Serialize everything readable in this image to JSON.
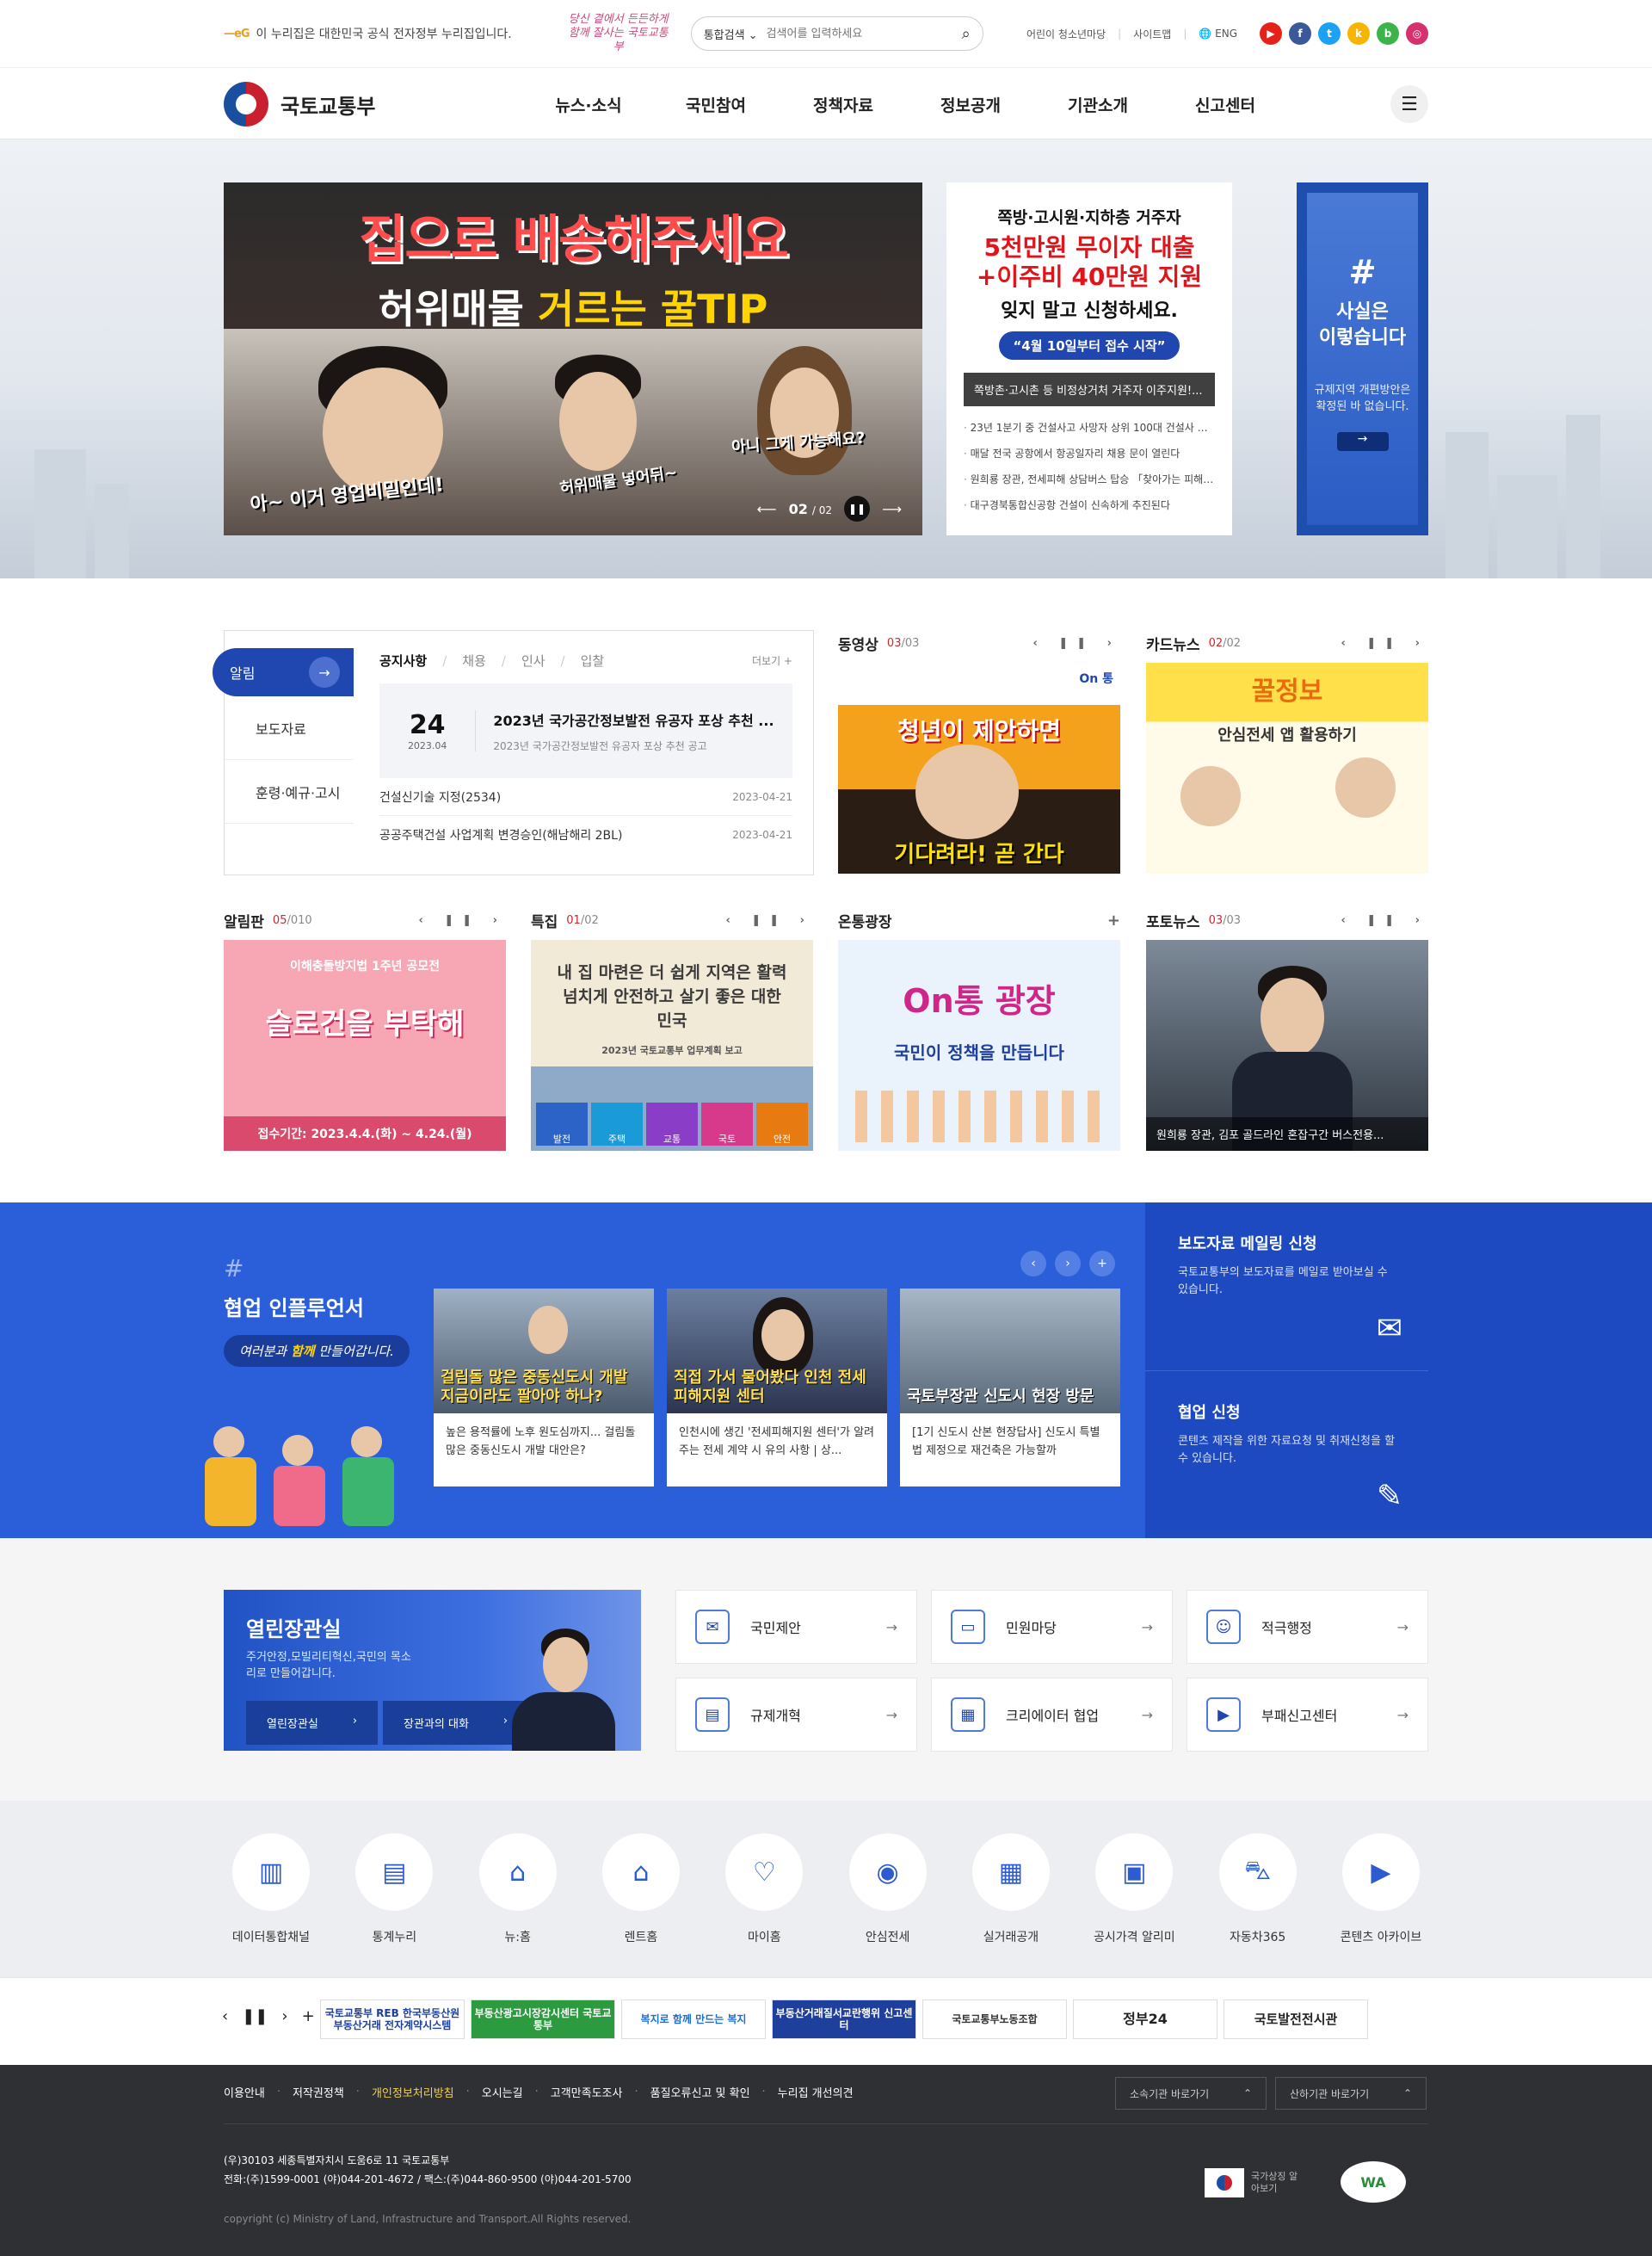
{
  "top": {
    "gov_mark": "이 누리집은 대한민국 공식 전자정부 누리집입니다.",
    "slogan": "당신 곁에서 든든하게 함께 잘사는 국토교통부",
    "search_scope": "통합검색",
    "search_placeholder": "검색어를 입력하세요",
    "util": [
      "어린이 청소년마당",
      "사이트맵",
      "ENG"
    ],
    "sns": [
      "youtube",
      "facebook",
      "twitter",
      "kakaostory",
      "blog",
      "instagram"
    ]
  },
  "gnb": {
    "logo": "국토교통부",
    "menu": [
      "뉴스·소식",
      "국민참여",
      "정책자료",
      "정보공개",
      "기관소개",
      "신고센터"
    ]
  },
  "hero": {
    "main_title": "집으로 배송해주세요",
    "main_sub_a": "허위매물 ",
    "main_sub_b": "거르는 꿀TIP",
    "cap1": "아~ 이거 영업비밀인데!",
    "cap2": "허위매물 넣어뒤~",
    "cap3": "아니 그게 가능해요?",
    "pager": "02",
    "pager_total": "/ 02",
    "card_a": "쪽방·고시원·지하층 거주자",
    "card_b1": "5천만원 무이자 대출",
    "card_b2": "+이주비 40만원 지원",
    "card_c": "잊지 말고 신청하세요.",
    "card_d": "“4월 10일부터 접수 시작”",
    "card_cap": "쪽방촌·고시촌 등 비정상거처 거주자 이주지원!...",
    "card_list": [
      "23년 1분기 중 건설사고 사망자 상위 100대 건설사 명단 ...",
      "매달 전국 공항에서 항공일자리 채용 문이 열린다",
      "원희룡 장관, 전세피해 상담버스 탑승 「찾아가는 피해지...",
      "대구경북통합신공항 건설이 신속하게 추진된다"
    ],
    "fact_hash": "#",
    "fact_t1": "사실은",
    "fact_t2": "이렇습니다",
    "fact_s": "규제지역 개편방안은 확정된 바 없습니다."
  },
  "notice": {
    "tabs": [
      "알림",
      "보도자료",
      "훈령·예규·고시"
    ],
    "subs": [
      "공지사항",
      "채용",
      "인사",
      "입찰"
    ],
    "more": "더보기 +",
    "feat_day": "24",
    "feat_ym": "2023.04",
    "feat_title": "2023년 국가공간정보발전 유공자 포상 추천 ...",
    "feat_sub": "2023년 국가공간정보발전 유공자 포상 추천 공고",
    "rows": [
      {
        "t": "건설신기술 지정(2534)",
        "d": "2023-04-21"
      },
      {
        "t": "공공주택건설 사업계획 변경승인(해남해리 2BL)",
        "d": "2023-04-21"
      }
    ]
  },
  "tiles": [
    {
      "title": "동영상",
      "cur": "03",
      "tot": "/03",
      "big": "청년이 제안하면",
      "sub": "기다려라! 곧 간다",
      "tag": "On 통"
    },
    {
      "title": "카드뉴스",
      "cur": "02",
      "tot": "/02",
      "big": "꿀정보",
      "sub": "안심전세 앱 활용하기"
    },
    {
      "title": "알림판",
      "cur": "05",
      "tot": "/010",
      "big": "슬로건을 부탁해",
      "sub": "접수기간: 2023.4.4.(화) ~ 4.24.(월)",
      "tag": "이해충돌방지법 1주년 공모전"
    },
    {
      "title": "특집",
      "cur": "01",
      "tot": "/02",
      "big": "내 집 마련은 더 쉽게 지역은 활력 넘치게 안전하고 살기 좋은 대한민국",
      "sub": "2023년 국토교통부 업무계획 보고",
      "chips": [
        "발전",
        "주택",
        "교통",
        "국토",
        "안전"
      ]
    },
    {
      "title": "온통광장",
      "cur": "",
      "tot": "",
      "big": "On통 광장",
      "sub": "국민이 정책을 만듭니다"
    },
    {
      "title": "포토뉴스",
      "cur": "03",
      "tot": "/03",
      "cap": "원희룡 장관, 김포 골드라인 혼잡구간 버스전용..."
    }
  ],
  "influencer": {
    "hash": "#",
    "title": "협업 인플루언서",
    "slogan_a": "여러분과 ",
    "slogan_b": "함께",
    "slogan_c": " 만들어갑니다.",
    "cards": [
      {
        "cap": "걸림돌 많은 중동신도시 개발 지금이라도 팔아야 하나?",
        "txt": "높은 용적률에 노후 원도심까지... 걸림돌 많은 중동신도시 개발 대안은?"
      },
      {
        "cap": "직접 가서 물어봤다 인천 전세피해지원 센터",
        "txt": "인천시에 생긴 '전세피해지원 센터'가 알려주는 전세 계약 시 유의 사항 | 상..."
      },
      {
        "cap": "국토부장관 신도시 현장 방문",
        "txt": "[1기 신도시 산본 현장답사] 신도시 특별법 제정으로 재건축은 가능할까"
      }
    ],
    "mail_t": "보도자료 메일링 신청",
    "mail_s": "국토교통부의 보도자료를 메일로 받아보실 수 있습니다.",
    "coop_t": "협업 신청",
    "coop_s": "콘텐츠 제작을 위한 자료요청 및 취재신청을 할 수 있습니다."
  },
  "open": {
    "title": "열린장관실",
    "sub": "주거안정,모빌리티혁신,국민의 목소리로 만들어갑니다.",
    "btn1": "열린장관실",
    "btn2": "장관과의 대화",
    "grid": [
      "국민제안",
      "민원마당",
      "적극행정",
      "규제개혁",
      "크리에이터 협업",
      "부패신고센터"
    ]
  },
  "quick": [
    "데이터통합채널",
    "통계누리",
    "뉴:홈",
    "렌트홈",
    "마이홈",
    "안심전세",
    "실거래공개",
    "공시가격 알리미",
    "자동차365",
    "콘텐츠 아카이브"
  ],
  "banners": [
    "국토교통부 REB 한국부동산원 부동산거래 전자계약시스템",
    "부동산광고시장감시센터 국토교통부",
    "복지로 함께 만드는 복지",
    "부동산거래질서교란행위 신고센터",
    "국토교통부노동조합",
    "정부24",
    "국토발전전시관"
  ],
  "footer": {
    "links": [
      "이용안내",
      "저작권정책",
      "개인정보처리방침",
      "오시는길",
      "고객만족도조사",
      "품질오류신고 및 확인",
      "누리집 개선의견"
    ],
    "sel1": "소속기관 바로가기",
    "sel2": "산하기관 바로가기",
    "addr": "(우)30103 세종특별자치시 도움6로 11 국토교통부",
    "tel": "전화:(주)1599-0001 (야)044-201-4672 / 팩스:(주)044-860-9500 (야)044-201-5700",
    "copy": "copyright (c) Ministry of Land, Infrastructure and Transport.All Rights reserved.",
    "mark": "국가상징 알아보기",
    "wa": "WA"
  }
}
